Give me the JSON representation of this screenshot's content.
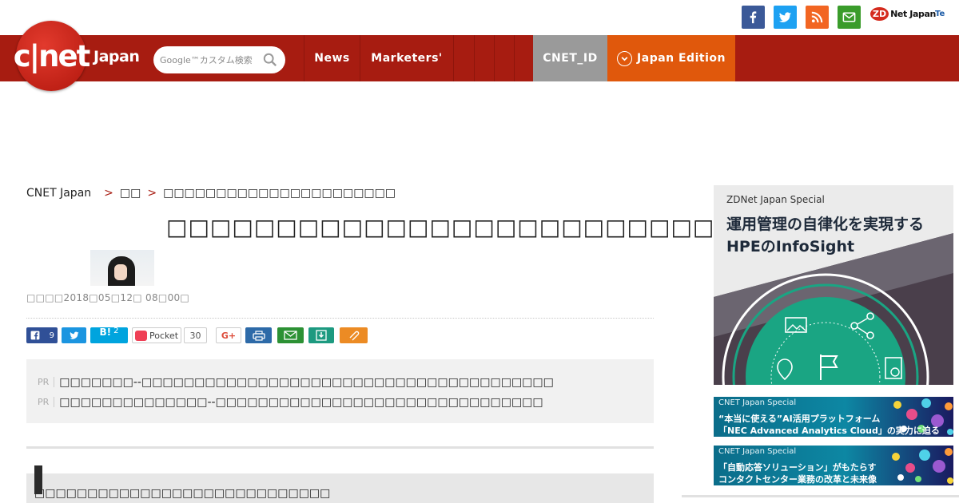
{
  "header": {
    "logo_text": "c|net",
    "logo_suffix": "Japan",
    "search_placeholder": "Google™カスタム検索",
    "nav": [
      "News",
      "Marketers'",
      "",
      "",
      "",
      ""
    ],
    "cnet_id": "CNET_ID",
    "edition": "Japan Edition"
  },
  "utility": {
    "zdnet_badge": "ZD",
    "zdnet_text": "Net Japan",
    "tech_text": "Te"
  },
  "breadcrumb": {
    "root": "CNET Japan",
    "sep1": ">",
    "section": "□□",
    "sep2": ">",
    "current": "□□□□□□□□□□□□□□□□□□□□□□"
  },
  "article": {
    "title": "□□□□□□□□□□□□□□□□□□□□□□□□□",
    "meta": "□□□□2018□05□12□ 08□00□"
  },
  "share": {
    "fb_count": "9",
    "hatena_label": "B!",
    "hatena_count": "2",
    "pocket_label": "Pocket",
    "pocket_count": "30",
    "gplus_label": "G+"
  },
  "pr": [
    {
      "tag": "PR",
      "text": "□□□□□□□--□□□□□□□□□□□□□□□□□□□□□□□□□□□□□□□□□□□□□□□"
    },
    {
      "tag": "PR",
      "text": "□□□□□□□□□□□□□□--□□□□□□□□□□□□□□□□□□□□□□□□□□□□□□□"
    }
  ],
  "section_heading": "□□□□□□□□□□□□□□□□□□□□□□□□□□□□",
  "ads": {
    "ad1": {
      "label": "ZDNet Japan Special",
      "line1": "運用管理の自律化を実現する",
      "line2": "HPEのInfoSight"
    },
    "ad2": {
      "label": "CNET Japan Special",
      "line1": "“本当に使える”AI活用プラットフォーム",
      "line2": "「NEC Advanced Analytics Cloud」の実力に迫る"
    },
    "ad3": {
      "label": "CNET Japan Special",
      "line1": "「自動応答ソリューション」がもたらす",
      "line2": "コンタクトセンター業務の改革と未来像"
    }
  },
  "colors": {
    "header_red": "#a71c11",
    "cnet_id_grey": "#9a9a9a",
    "edition_orange": "#e0580c",
    "ad1_green": "#1aa583"
  }
}
